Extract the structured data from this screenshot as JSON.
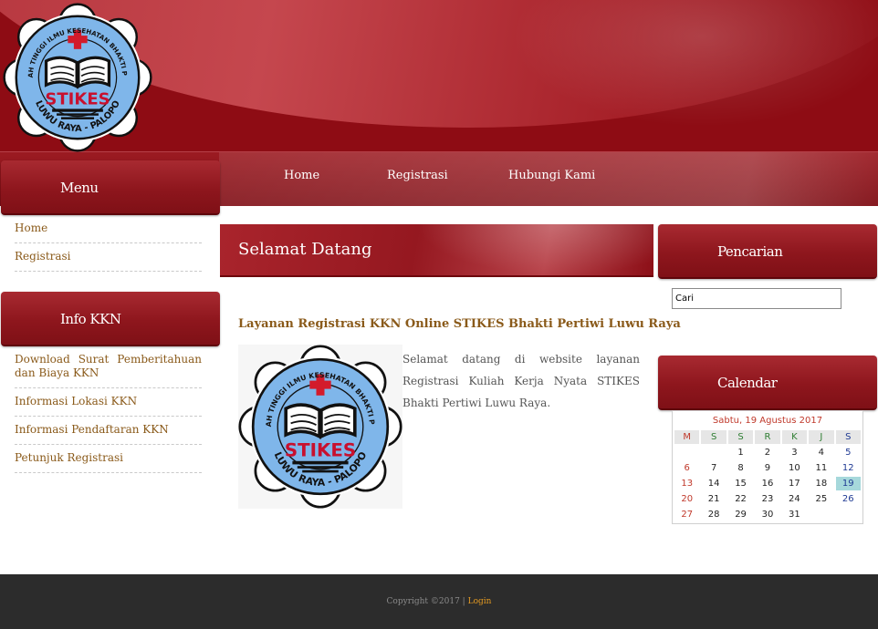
{
  "logo": {
    "arc_text": "SEKOLAH TINGGI ILMU KESEHATAN BHAKTI PERTIWI",
    "acronym": "STIKES",
    "bottom_text": "LUWU RAYA - PALOPO"
  },
  "topnav": {
    "items": [
      "Home",
      "Registrasi",
      "Hubungi Kami"
    ]
  },
  "sidebar": {
    "menu_title": "Menu",
    "menu_items": [
      "Home",
      "Registrasi"
    ],
    "info_title": "Info KKN",
    "info_items": [
      "Download Surat Pemberitahuan dan Biaya KKN",
      "Informasi Lokasi KKN",
      "Informasi Pendaftaran KKN",
      "Petunjuk Registrasi"
    ]
  },
  "main": {
    "heading": "Selamat Datang",
    "subtitle": "Layanan Registrasi KKN Online STIKES Bhakti Pertiwi Luwu Raya",
    "welcome_text": "Selamat datang di website layanan Registrasi Kuliah Kerja Nyata STIKES Bhakti Pertiwi Luwu Raya."
  },
  "right": {
    "search_title": "Pencarian",
    "search_value": "Cari",
    "calendar_title": "Calendar"
  },
  "calendar": {
    "caption": "Sabtu, 19 Agustus 2017",
    "headers": [
      "M",
      "S",
      "S",
      "R",
      "K",
      "J",
      "S"
    ],
    "weeks": [
      [
        "",
        "",
        "1",
        "2",
        "3",
        "4",
        "5"
      ],
      [
        "6",
        "7",
        "8",
        "9",
        "10",
        "11",
        "12"
      ],
      [
        "13",
        "14",
        "15",
        "16",
        "17",
        "18",
        "19"
      ],
      [
        "20",
        "21",
        "22",
        "23",
        "24",
        "25",
        "26"
      ],
      [
        "27",
        "28",
        "29",
        "30",
        "31",
        "",
        ""
      ]
    ],
    "today": "19"
  },
  "footer": {
    "copyright": "Copyright ©2017 |",
    "login": "Login"
  },
  "colors": {
    "header_red": "#8e0c14",
    "link_brown": "#8a5a1a",
    "footer_bg": "#2c2c2c",
    "footer_link": "#e49a22",
    "today_highlight": "#a6d8db",
    "logo_blue": "#7fb6ea"
  }
}
